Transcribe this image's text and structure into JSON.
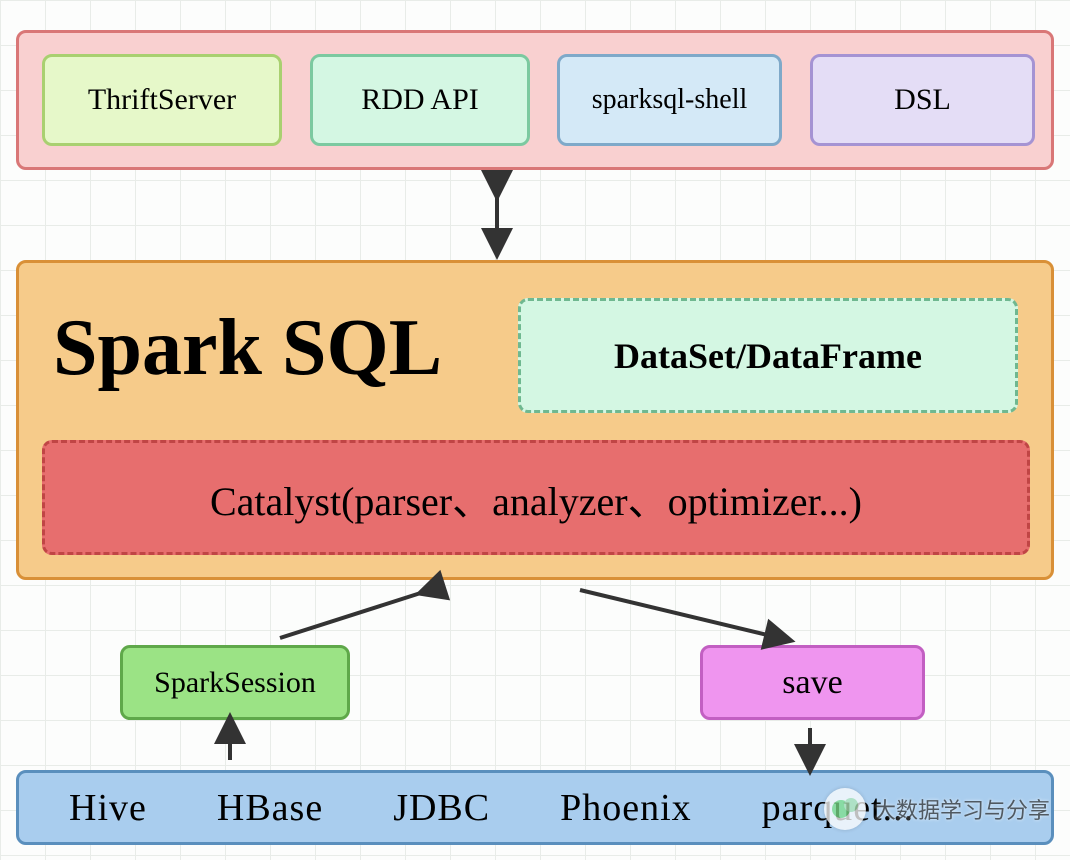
{
  "top": {
    "thrift": "ThriftServer",
    "rdd": "RDD API",
    "sshell": "sparksql-shell",
    "dsl": "DSL"
  },
  "mid": {
    "title": "Spark SQL",
    "dsdf": "DataSet/DataFrame",
    "catalyst": "Catalyst(parser、analyzer、optimizer...)"
  },
  "flow": {
    "session": "SparkSession",
    "save": "save"
  },
  "bottom": {
    "items": [
      "Hive",
      "HBase",
      "JDBC",
      "Phoenix",
      "parquet..."
    ]
  },
  "watermark": "大数据学习与分享"
}
